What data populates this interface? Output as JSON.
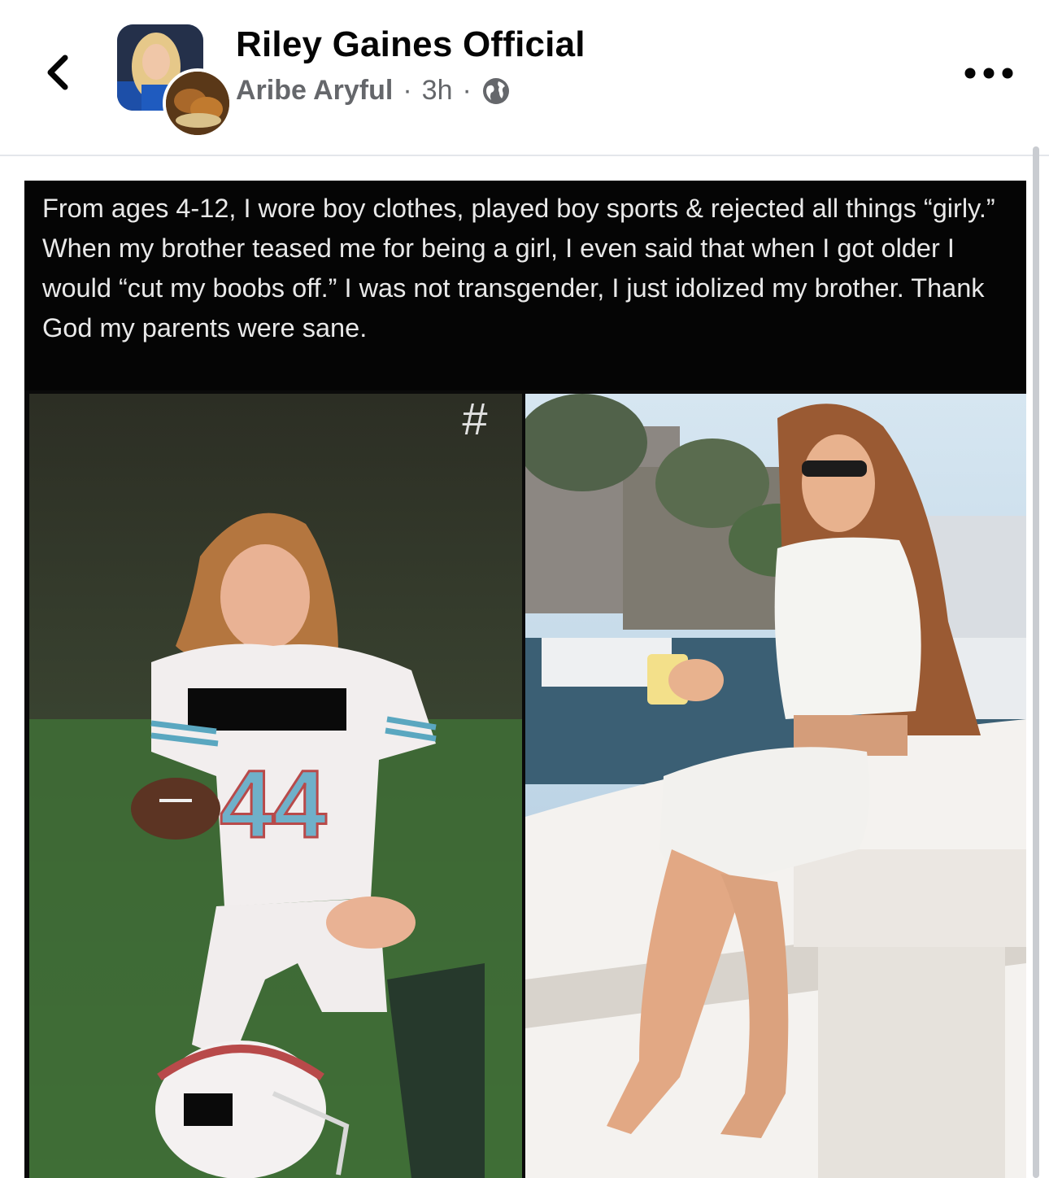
{
  "header": {
    "page_name": "Riley Gaines Official",
    "author": "Aribe Aryful",
    "separator": "·",
    "time": "3h",
    "back_icon": "chevron-left-icon",
    "privacy_icon": "globe-icon",
    "more_icon": "more-horizontal-icon"
  },
  "post": {
    "caption": "From ages 4-12, I wore boy clothes, played boy sports & rejected all things “girly.” When my brother teased me for being a girl, I even said that when I got older I would “cut my boobs off.” I was not transgender, I just idolized my brother. Thank God my parents were sane.",
    "left_photo": {
      "hash_mark": "#",
      "jersey_number": "44"
    }
  },
  "colors": {
    "title": "#050505",
    "meta": "#65676b",
    "divider": "#e4e6eb",
    "caption_bg": "#050505",
    "caption_text": "#e9e9e9"
  }
}
